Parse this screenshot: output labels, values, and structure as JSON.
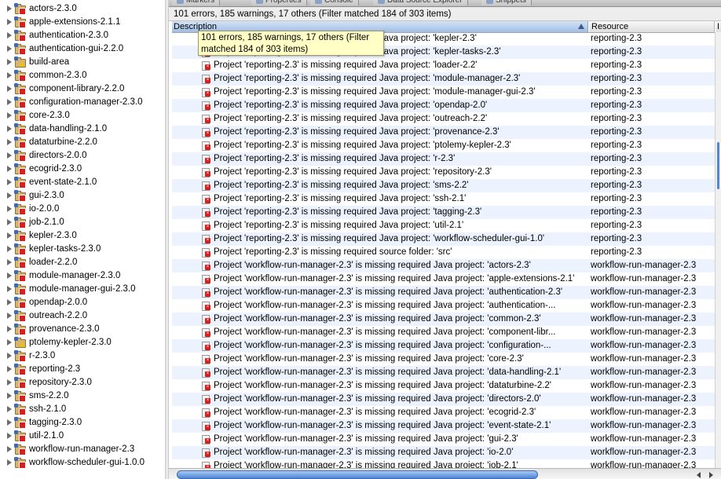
{
  "tabs": [
    {
      "label": "Markers",
      "icon": "markers-icon"
    },
    {
      "label": "Properties",
      "icon": "properties-icon"
    },
    {
      "label": "Console",
      "icon": "console-icon"
    },
    {
      "label": "Data Source Explorer",
      "icon": "database-icon"
    },
    {
      "label": "Snippets",
      "icon": "snippets-icon"
    }
  ],
  "summary": "101 errors, 185 warnings, 17 others (Filter matched 184 of 303 items)",
  "tooltip": {
    "line1": "101 errors, 185 warnings, 17 others (Filter",
    "line2": "matched 184 of 303 items)"
  },
  "table": {
    "headers": {
      "description": "Description",
      "resource": "Resource",
      "extra": "I"
    },
    "rows": [
      {
        "desc": "Project 'reporting-2.3' is missing required Java project: 'kepler-2.3'",
        "res": "reporting-2.3"
      },
      {
        "desc": "Project 'reporting-2.3' is missing required Java project: 'kepler-tasks-2.3'",
        "res": "reporting-2.3"
      },
      {
        "desc": "Project 'reporting-2.3' is missing required Java project: 'loader-2.2'",
        "res": "reporting-2.3"
      },
      {
        "desc": "Project 'reporting-2.3' is missing required Java project: 'module-manager-2.3'",
        "res": "reporting-2.3"
      },
      {
        "desc": "Project 'reporting-2.3' is missing required Java project: 'module-manager-gui-2.3'",
        "res": "reporting-2.3"
      },
      {
        "desc": "Project 'reporting-2.3' is missing required Java project: 'opendap-2.0'",
        "res": "reporting-2.3"
      },
      {
        "desc": "Project 'reporting-2.3' is missing required Java project: 'outreach-2.2'",
        "res": "reporting-2.3"
      },
      {
        "desc": "Project 'reporting-2.3' is missing required Java project: 'provenance-2.3'",
        "res": "reporting-2.3"
      },
      {
        "desc": "Project 'reporting-2.3' is missing required Java project: 'ptolemy-kepler-2.3'",
        "res": "reporting-2.3"
      },
      {
        "desc": "Project 'reporting-2.3' is missing required Java project: 'r-2.3'",
        "res": "reporting-2.3"
      },
      {
        "desc": "Project 'reporting-2.3' is missing required Java project: 'repository-2.3'",
        "res": "reporting-2.3"
      },
      {
        "desc": "Project 'reporting-2.3' is missing required Java project: 'sms-2.2'",
        "res": "reporting-2.3"
      },
      {
        "desc": "Project 'reporting-2.3' is missing required Java project: 'ssh-2.1'",
        "res": "reporting-2.3"
      },
      {
        "desc": "Project 'reporting-2.3' is missing required Java project: 'tagging-2.3'",
        "res": "reporting-2.3"
      },
      {
        "desc": "Project 'reporting-2.3' is missing required Java project: 'util-2.1'",
        "res": "reporting-2.3"
      },
      {
        "desc": "Project 'reporting-2.3' is missing required Java project: 'workflow-scheduler-gui-1.0'",
        "res": "reporting-2.3"
      },
      {
        "desc": "Project 'reporting-2.3' is missing required source folder: 'src'",
        "res": "reporting-2.3"
      },
      {
        "desc": "Project 'workflow-run-manager-2.3' is missing required Java project: 'actors-2.3'",
        "res": "workflow-run-manager-2.3"
      },
      {
        "desc": "Project 'workflow-run-manager-2.3' is missing required Java project: 'apple-extensions-2.1'",
        "res": "workflow-run-manager-2.3"
      },
      {
        "desc": "Project 'workflow-run-manager-2.3' is missing required Java project: 'authentication-2.3'",
        "res": "workflow-run-manager-2.3"
      },
      {
        "desc": "Project 'workflow-run-manager-2.3' is missing required Java project: 'authentication-...",
        "res": "workflow-run-manager-2.3"
      },
      {
        "desc": "Project 'workflow-run-manager-2.3' is missing required Java project: 'common-2.3'",
        "res": "workflow-run-manager-2.3"
      },
      {
        "desc": "Project 'workflow-run-manager-2.3' is missing required Java project: 'component-libr...",
        "res": "workflow-run-manager-2.3"
      },
      {
        "desc": "Project 'workflow-run-manager-2.3' is missing required Java project: 'configuration-...",
        "res": "workflow-run-manager-2.3"
      },
      {
        "desc": "Project 'workflow-run-manager-2.3' is missing required Java project: 'core-2.3'",
        "res": "workflow-run-manager-2.3"
      },
      {
        "desc": "Project 'workflow-run-manager-2.3' is missing required Java project: 'data-handling-2.1'",
        "res": "workflow-run-manager-2.3"
      },
      {
        "desc": "Project 'workflow-run-manager-2.3' is missing required Java project: 'dataturbine-2.2'",
        "res": "workflow-run-manager-2.3"
      },
      {
        "desc": "Project 'workflow-run-manager-2.3' is missing required Java project: 'directors-2.0'",
        "res": "workflow-run-manager-2.3"
      },
      {
        "desc": "Project 'workflow-run-manager-2.3' is missing required Java project: 'ecogrid-2.3'",
        "res": "workflow-run-manager-2.3"
      },
      {
        "desc": "Project 'workflow-run-manager-2.3' is missing required Java project: 'event-state-2.1'",
        "res": "workflow-run-manager-2.3"
      },
      {
        "desc": "Project 'workflow-run-manager-2.3' is missing required Java project: 'gui-2.3'",
        "res": "workflow-run-manager-2.3"
      },
      {
        "desc": "Project 'workflow-run-manager-2.3' is missing required Java project: 'io-2.0'",
        "res": "workflow-run-manager-2.3"
      },
      {
        "desc": "Project 'workflow-run-manager-2.3' is missing required Java project: 'job-2.1'",
        "res": "workflow-run-manager-2.3"
      }
    ]
  },
  "tree": [
    {
      "label": "actors-2.3.0",
      "badge": "err"
    },
    {
      "label": "apple-extensions-2.1.1",
      "badge": "err"
    },
    {
      "label": "authentication-2.3.0",
      "badge": "err"
    },
    {
      "label": "authentication-gui-2.2.0",
      "badge": "err"
    },
    {
      "label": "build-area",
      "badge": "warn"
    },
    {
      "label": "common-2.3.0",
      "badge": "err"
    },
    {
      "label": "component-library-2.2.0",
      "badge": "err"
    },
    {
      "label": "configuration-manager-2.3.0",
      "badge": "err"
    },
    {
      "label": "core-2.3.0",
      "badge": "err"
    },
    {
      "label": "data-handling-2.1.0",
      "badge": "err"
    },
    {
      "label": "dataturbine-2.2.0",
      "badge": "err"
    },
    {
      "label": "directors-2.0.0",
      "badge": "err"
    },
    {
      "label": "ecogrid-2.3.0",
      "badge": "err"
    },
    {
      "label": "event-state-2.1.0",
      "badge": "err"
    },
    {
      "label": "gui-2.3.0",
      "badge": "err"
    },
    {
      "label": "io-2.0.0",
      "badge": "err"
    },
    {
      "label": "job-2.1.0",
      "badge": "err"
    },
    {
      "label": "kepler-2.3.0",
      "badge": "err"
    },
    {
      "label": "kepler-tasks-2.3.0",
      "badge": "err"
    },
    {
      "label": "loader-2.2.0",
      "badge": "err"
    },
    {
      "label": "module-manager-2.3.0",
      "badge": "err"
    },
    {
      "label": "module-manager-gui-2.3.0",
      "badge": "err"
    },
    {
      "label": "opendap-2.0.0",
      "badge": "err"
    },
    {
      "label": "outreach-2.2.0",
      "badge": "err"
    },
    {
      "label": "provenance-2.3.0",
      "badge": "err"
    },
    {
      "label": "ptolemy-kepler-2.3.0",
      "badge": "warn"
    },
    {
      "label": "r-2.3.0",
      "badge": "err"
    },
    {
      "label": "reporting-2.3",
      "badge": "err"
    },
    {
      "label": "repository-2.3.0",
      "badge": "err"
    },
    {
      "label": "sms-2.2.0",
      "badge": "err"
    },
    {
      "label": "ssh-2.1.0",
      "badge": "err"
    },
    {
      "label": "tagging-2.3.0",
      "badge": "err"
    },
    {
      "label": "util-2.1.0",
      "badge": "err"
    },
    {
      "label": "workflow-run-manager-2.3",
      "badge": "err"
    },
    {
      "label": "workflow-scheduler-gui-1.0.0",
      "badge": "err"
    }
  ],
  "colors": {
    "selected_header": "#9fbde6",
    "alt_row": "#edf3fe",
    "error": "#d81e1e",
    "warning": "#e8c21a",
    "tooltip_bg": "#ffffc6"
  }
}
